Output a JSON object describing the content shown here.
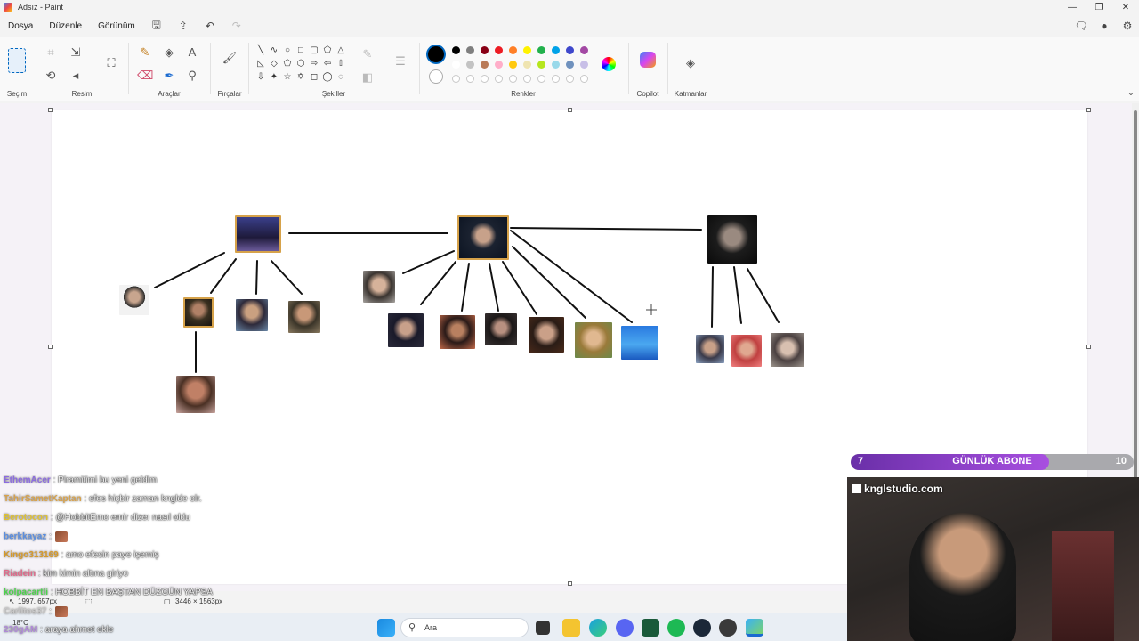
{
  "window": {
    "title": "Adsız - Paint"
  },
  "menu": {
    "items": [
      "Dosya",
      "Düzenle",
      "Görünüm"
    ]
  },
  "ribbon": {
    "groups": {
      "secim": "Seçim",
      "resim": "Resim",
      "araclar": "Araçlar",
      "fircalar": "Fırçalar",
      "sekiller": "Şekiller",
      "renkler": "Renkler",
      "copilot": "Copilot",
      "katmanlar": "Katmanlar"
    },
    "palette_row1": [
      "#000000",
      "#7f7f7f",
      "#880015",
      "#ed1c24",
      "#ff7f27",
      "#fff200",
      "#22b14c",
      "#00a2e8",
      "#3f48cc",
      "#a349a4"
    ],
    "palette_row2": [
      "#ffffff",
      "#c3c3c3",
      "#b97a57",
      "#ffaec9",
      "#ffc90e",
      "#efe4b0",
      "#b5e61d",
      "#99d9ea",
      "#7092be",
      "#c8bfe7"
    ],
    "primary_color": "#000000"
  },
  "status": {
    "cursor_pos": "1997, 657px",
    "canvas_size": "3446 × 1563px"
  },
  "taskbar": {
    "search_placeholder": "Ara"
  },
  "chat": {
    "messages": [
      {
        "user": "EthemAcer",
        "color": "#8b6be0",
        "text": ": Piramitimi bu yeni geldim"
      },
      {
        "user": "TahirSametKaptan",
        "color": "#d8a24a",
        "text": ": efes hiçbir zaman knglde olr."
      },
      {
        "user": "Berotocon",
        "color": "#e0c232",
        "text": ": @HobbitEmo emir dizeı nasıl oldu"
      },
      {
        "user": "berkkayaz",
        "color": "#5a8ee0",
        "text": ":",
        "emote": true
      },
      {
        "user": "Kingo313169",
        "color": "#d69a2a",
        "text": ": amo efesin paye işemiş"
      },
      {
        "user": "Riadein",
        "color": "#e06a8a",
        "text": ": kim kimin altına giriyo"
      },
      {
        "user": "kolpacartli",
        "color": "#4cd44c",
        "text": ": HOBBİT EN BAŞTAN DÜZGÜN YAPSA"
      },
      {
        "user": "Carlitos37",
        "color": "#c8c8c8",
        "text": ":",
        "emote": true
      },
      {
        "user": "230gAM",
        "color": "#b08ad8",
        "text": ": araya ahmet ekle"
      }
    ]
  },
  "overlay": {
    "sub_current": "7",
    "sub_label": "GÜNLÜK ABONE",
    "sub_goal": "10",
    "sub_progress": 0.7,
    "brand": "knglstudio.com"
  },
  "weather": {
    "temp": "18°C"
  }
}
